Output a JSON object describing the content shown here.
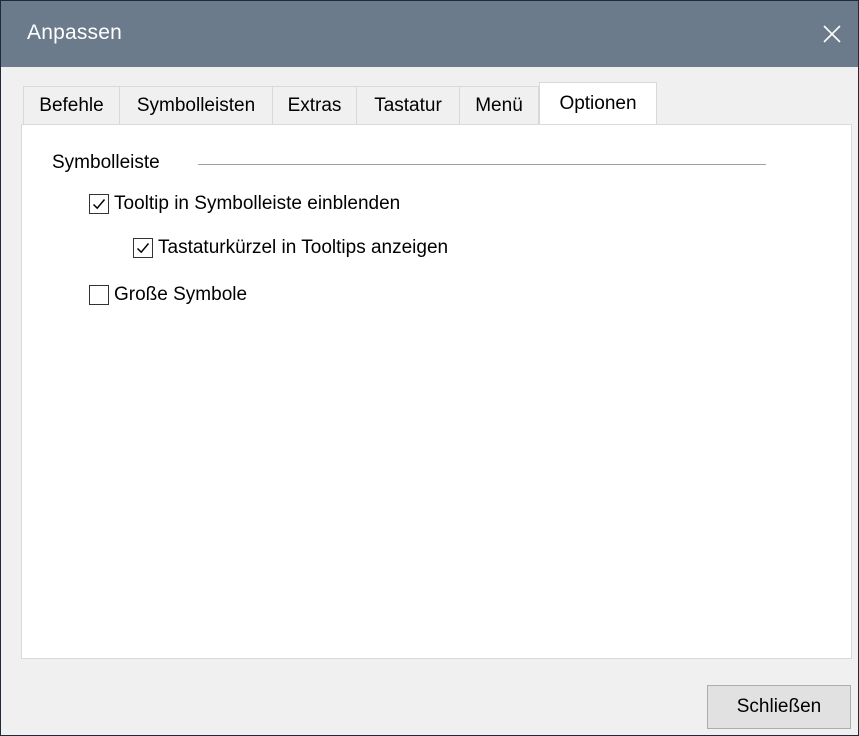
{
  "window": {
    "title": "Anpassen"
  },
  "tabs": [
    {
      "label": "Befehle",
      "active": false
    },
    {
      "label": "Symbolleisten",
      "active": false
    },
    {
      "label": "Extras",
      "active": false
    },
    {
      "label": "Tastatur",
      "active": false
    },
    {
      "label": "Menü",
      "active": false
    },
    {
      "label": "Optionen",
      "active": true
    }
  ],
  "options": {
    "group_label": "Symbolleiste",
    "checkboxes": [
      {
        "label": "Tooltip in Symbolleiste einblenden",
        "checked": true
      },
      {
        "label": "Tastaturkürzel in Tooltips anzeigen",
        "checked": true
      },
      {
        "label": "Große Symbole",
        "checked": false
      }
    ]
  },
  "footer": {
    "close_label": "Schließen"
  },
  "colors": {
    "titlebar": "#6b7b8c",
    "window_bg": "#f0f0f0",
    "panel_bg": "#ffffff",
    "button_bg": "#e1e1e1"
  },
  "icons": {
    "close": "close-icon",
    "check": "checkmark-icon"
  }
}
